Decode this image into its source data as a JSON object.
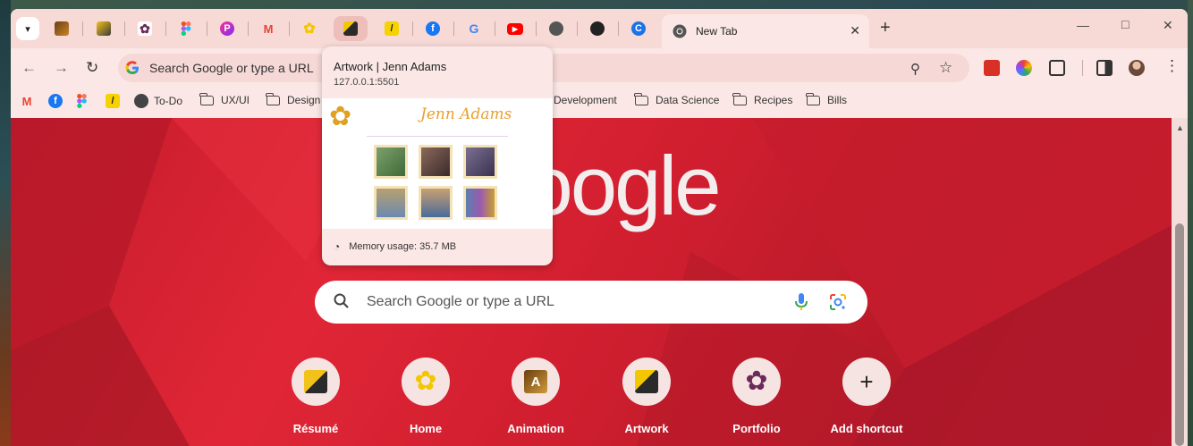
{
  "tabstrip": {
    "pinned_tabs": [
      {
        "name": "animation-tab",
        "icon": "animation-logo-icon",
        "color": "#8b5a1c"
      },
      {
        "name": "resume-tab",
        "icon": "sunflower-resume-icon",
        "color": "#3a3a3a"
      },
      {
        "name": "portfolio-tab",
        "icon": "flower-portfolio-icon",
        "color": "#6b2a5a"
      },
      {
        "name": "figma-tab",
        "icon": "figma-icon",
        "color": "#f24e1e"
      },
      {
        "name": "picsart-tab",
        "icon": "picsart-icon",
        "color": "#c13584"
      },
      {
        "name": "gmail-tab",
        "icon": "gmail-icon",
        "color": "#ea4335"
      },
      {
        "name": "home-tab",
        "icon": "yellow-flower-icon",
        "color": "#f2c700"
      },
      {
        "name": "artwork-tab",
        "icon": "artwork-leaf-icon",
        "color": "#2a2a2a"
      },
      {
        "name": "todo-tab",
        "icon": "todo-icon",
        "color": "#f6d200"
      },
      {
        "name": "facebook-tab",
        "icon": "facebook-icon",
        "color": "#1877f2"
      },
      {
        "name": "google-tab",
        "icon": "google-icon",
        "color": "#4285f4"
      },
      {
        "name": "youtube-tab",
        "icon": "youtube-icon",
        "color": "#ff0000"
      },
      {
        "name": "web-tab",
        "icon": "globe-icon",
        "color": "#555555"
      },
      {
        "name": "github-tab",
        "icon": "github-icon",
        "color": "#222222"
      },
      {
        "name": "chrome-c-tab",
        "icon": "c-logo-icon",
        "color": "#1a73e8"
      }
    ],
    "active_tab": {
      "label": "New Tab",
      "icon": "chrome-icon"
    },
    "new_tab_label": "+"
  },
  "toolbar": {
    "omnibox_placeholder": "Search Google or type a URL"
  },
  "bookmarks": [
    {
      "label": "",
      "icon": "gmail-icon"
    },
    {
      "label": "",
      "icon": "facebook-icon"
    },
    {
      "label": "",
      "icon": "figma-icon"
    },
    {
      "label": "",
      "icon": "todo-icon"
    },
    {
      "label": "To-Do",
      "icon": "globe-icon"
    },
    {
      "label": "UX/UI",
      "icon": "folder-icon"
    },
    {
      "label": "Design",
      "icon": "folder-icon"
    },
    {
      "label": "Development",
      "icon": "folder-icon"
    },
    {
      "label": "Data Science",
      "icon": "folder-icon"
    },
    {
      "label": "Recipes",
      "icon": "folder-icon"
    },
    {
      "label": "Bills",
      "icon": "folder-icon"
    }
  ],
  "hover_card": {
    "title": "Artwork | Jenn Adams",
    "url": "127.0.0.1:5501",
    "brand": "Jenn Adams",
    "memory": "Memory usage: 35.7 MB"
  },
  "newtab": {
    "logo": "Google",
    "search_placeholder": "Search Google or type a URL",
    "shortcuts": [
      {
        "label": "Résumé",
        "icon": "sunflower-resume-icon"
      },
      {
        "label": "Home",
        "icon": "yellow-flower-icon"
      },
      {
        "label": "Animation",
        "icon": "animation-logo-icon"
      },
      {
        "label": "Artwork",
        "icon": "artwork-leaf-icon"
      },
      {
        "label": "Portfolio",
        "icon": "flower-portfolio-icon"
      },
      {
        "label": "Add shortcut",
        "icon": "plus-icon"
      }
    ]
  },
  "colors": {
    "frame": "#f7d9d6",
    "toolbar": "#fbe8e6",
    "ntp_red": "#d21f30"
  }
}
